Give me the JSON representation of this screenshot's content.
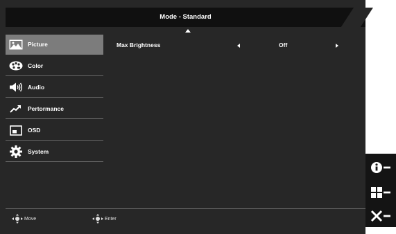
{
  "header": {
    "title": "Mode - Standard"
  },
  "sidebar": {
    "items": [
      {
        "label": "Picture",
        "icon": "picture-icon",
        "active": true
      },
      {
        "label": "Color",
        "icon": "palette-icon",
        "active": false
      },
      {
        "label": "Audio",
        "icon": "speaker-icon",
        "active": false
      },
      {
        "label": "Pertormance",
        "icon": "performance-arrow-icon",
        "active": false
      },
      {
        "label": "OSD",
        "icon": "osd-window-icon",
        "active": false
      },
      {
        "label": "System",
        "icon": "gear-icon",
        "active": false
      }
    ]
  },
  "content": {
    "settings": [
      {
        "label": "Max Brightness",
        "value": "Off"
      }
    ]
  },
  "footer": {
    "hints": [
      {
        "label": "Move",
        "icon": "joystick-move-icon"
      },
      {
        "label": "Enter",
        "icon": "joystick-enter-icon"
      }
    ]
  },
  "side_keys": [
    {
      "icon": "info-icon"
    },
    {
      "icon": "input-grid-icon"
    },
    {
      "icon": "close-icon"
    }
  ],
  "colors": {
    "panel": "#272727",
    "title_bar": "#101010",
    "active_item": "#7c7c7c",
    "divider": "#6a6a6a"
  }
}
